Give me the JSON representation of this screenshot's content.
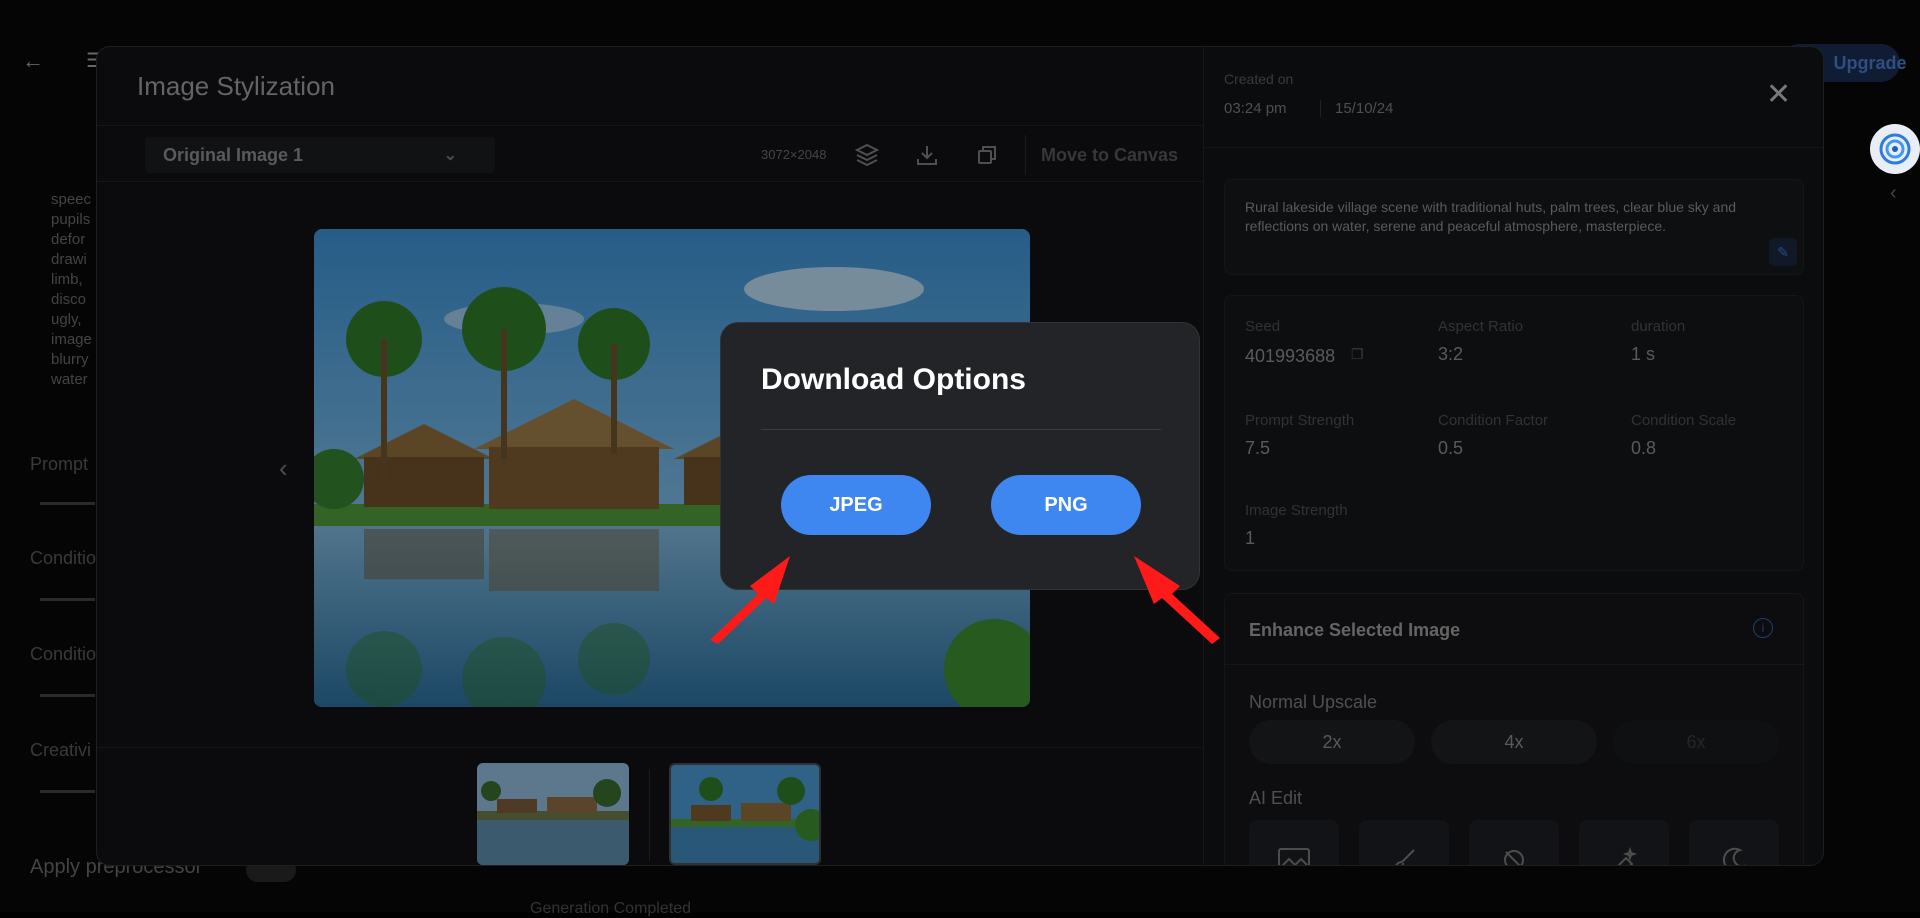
{
  "background": {
    "upgrade_label": "Upgrade",
    "negative_prompt_snippet": [
      "speec",
      "pupils",
      "defor",
      "drawi",
      "limb,",
      "disco",
      "ugly,",
      "image",
      "blurry",
      "water"
    ],
    "slider_labels": [
      "Prompt",
      "Conditio",
      "Conditio",
      "Creativi"
    ],
    "apply_label": "Apply preprocessor",
    "generate_hint": "Generation Completed"
  },
  "modal": {
    "title": "Image Stylization",
    "image_select": "Original Image 1",
    "dimensions": "3072×2048",
    "move_to_canvas": "Move to Canvas",
    "thumbnails": [
      "thumbnail-1",
      "thumbnail-2"
    ],
    "selected_thumbnail": 2
  },
  "details": {
    "created_label": "Created on",
    "time": "03:24 pm",
    "date": "15/10/24",
    "prompt": "Rural lakeside village scene with traditional huts, palm trees, clear blue sky and reflections on water, serene and peaceful atmosphere, masterpiece.",
    "params": {
      "seed_label": "Seed",
      "seed": "401993688",
      "aspect_label": "Aspect Ratio",
      "aspect": "3:2",
      "duration_label": "duration",
      "duration": "1 s",
      "prompt_strength_label": "Prompt Strength",
      "prompt_strength": "7.5",
      "condition_factor_label": "Condition Factor",
      "condition_factor": "0.5",
      "condition_scale_label": "Condition Scale",
      "condition_scale": "0.8",
      "image_strength_label": "Image Strength",
      "image_strength": "1"
    },
    "enhance": {
      "title": "Enhance Selected Image",
      "normal_upscale_label": "Normal Upscale",
      "upscale_options": [
        "2x",
        "4x",
        "6x"
      ],
      "ai_edit_label": "AI Edit"
    }
  },
  "download_popup": {
    "title": "Download Options",
    "jpeg_label": "JPEG",
    "png_label": "PNG"
  },
  "colors": {
    "accent": "#3e86f0",
    "arrow": "#ff1a1a"
  }
}
